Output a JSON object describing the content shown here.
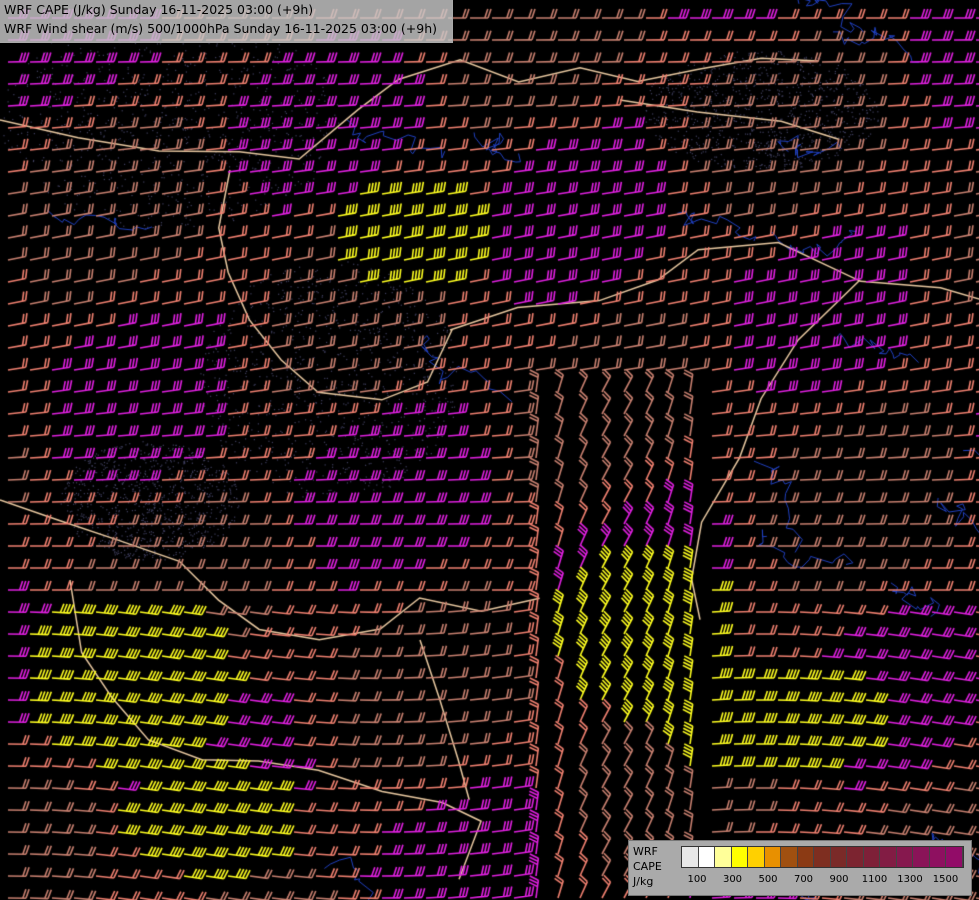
{
  "titles": {
    "line1": "WRF CAPE (J/kg) Sunday 16-11-2025 03:00 (+9h)",
    "line2": "WRF Wind shear (m/s) 500/1000hPa Sunday 16-11-2025 03:00 (+9h)"
  },
  "legend": {
    "label_model": "WRF",
    "label_param": "CAPE",
    "label_unit": "J/kg",
    "colors": [
      "#e8e8e8",
      "#ffffff",
      "#ffff99",
      "#ffff00",
      "#ffd000",
      "#e89000",
      "#a05010",
      "#8b3a14",
      "#7e2e20",
      "#7a2a28",
      "#7c2430",
      "#7e2038",
      "#821c44",
      "#86184e",
      "#8a1458",
      "#8e1060",
      "#920c68"
    ],
    "ticks": [
      "100",
      "300",
      "500",
      "700",
      "900",
      "1100",
      "1300",
      "1500"
    ]
  },
  "colors": {
    "background": "#000000",
    "barb_magenta": "#e020e0",
    "barb_salmon": "#f08070",
    "barb_brown": "#c88070",
    "barb_yellow": "#ffff20",
    "borders": "#e8c8a0",
    "rivers": "#2040c0",
    "lakes": "#404060"
  }
}
